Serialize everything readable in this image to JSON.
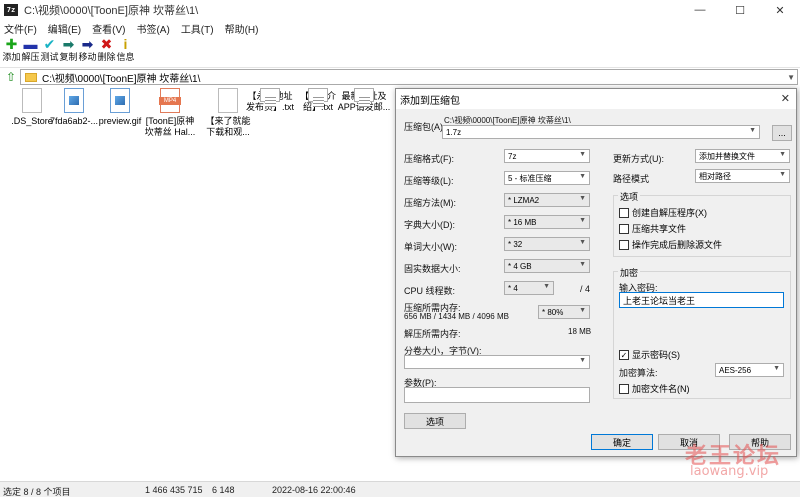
{
  "window": {
    "title": "C:\\视频\\0000\\[ToonE]原神 坎蒂丝\\1\\",
    "icon_text": "7z"
  },
  "menu": [
    "文件(F)",
    "编辑(E)",
    "查看(V)",
    "书签(A)",
    "工具(T)",
    "帮助(H)"
  ],
  "toolbar": [
    {
      "label": "添加",
      "icon": "plus-icon",
      "glyph": "✚",
      "color": "#1aa51a"
    },
    {
      "label": "解压",
      "icon": "minus-icon",
      "glyph": "▬",
      "color": "#2233aa"
    },
    {
      "label": "测试",
      "icon": "check-icon",
      "glyph": "✔",
      "color": "#19b3c4"
    },
    {
      "label": "复制",
      "icon": "copy-arrow-icon",
      "glyph": "➡",
      "color": "#1a7a6a"
    },
    {
      "label": "移动",
      "icon": "move-arrow-icon",
      "glyph": "➡",
      "color": "#1a2a8a"
    },
    {
      "label": "删除",
      "icon": "delete-x-icon",
      "glyph": "✖",
      "color": "#d01818"
    },
    {
      "label": "信息",
      "icon": "info-icon",
      "glyph": "i",
      "color": "#c9a000"
    }
  ],
  "address": {
    "path": "C:\\视频\\0000\\[ToonE]原神 坎蒂丝\\1\\"
  },
  "files": [
    {
      "name": ".DS_Store",
      "type": "blank"
    },
    {
      "name": "7fda6ab2-...",
      "type": "img"
    },
    {
      "name": "preview.gif",
      "type": "img"
    },
    {
      "name": "[ToonE]原神\n坎蒂丝 Hal...",
      "type": "mp4"
    },
    {
      "name": "【来了就能\n下载和观...",
      "type": "blank"
    },
    {
      "name": "【永久地址\n发布页】.txt",
      "type": "txt"
    },
    {
      "name": "【论坛介\n绍】.txt",
      "type": "txt"
    },
    {
      "name": "最新地址及\nAPP请发邮...",
      "type": "txt"
    }
  ],
  "status": {
    "selected": "选定 8 / 8 个项目",
    "size": "1 466 435 715",
    "packed": "6 148",
    "modified": "2022-08-16 22:00:46"
  },
  "dialog": {
    "title": "添加到压缩包",
    "archive_label": "压缩包(A):",
    "archive_path": "C:\\视频\\0000\\[ToonE]原神 坎蒂丝\\1\\",
    "archive_name": "1.7z",
    "browse_label": "...",
    "format_label": "压缩格式(F):",
    "format_value": "7z",
    "level_label": "压缩等级(L):",
    "level_value": "5 - 标准压缩",
    "method_label": "压缩方法(M):",
    "method_value": "* LZMA2",
    "dict_label": "字典大小(D):",
    "dict_value": "* 16 MB",
    "word_label": "单词大小(W):",
    "word_value": "* 32",
    "solid_label": "固实数据大小:",
    "solid_value": "* 4 GB",
    "cpu_label": "CPU 线程数:",
    "cpu_value": "* 4",
    "cpu_total": "/ 4",
    "mem_label": "压缩所需内存:",
    "mem_values": "656 MB / 1434 MB / 4096 MB",
    "mem_percent": "* 80%",
    "decomp_label": "解压所需内存:",
    "decomp_value": "18 MB",
    "split_label": "分卷大小，字节(V):",
    "params_label": "参数(P):",
    "options_button": "选项",
    "update_label": "更新方式(U):",
    "update_value": "添加并替换文件",
    "path_label": "路径模式",
    "path_value": "相对路径",
    "options_group": "选项",
    "opt_sfx": "创建自解压程序(X)",
    "opt_shared": "压缩共享文件",
    "opt_delete": "操作完成后删除源文件",
    "encrypt_group": "加密",
    "password_label": "输入密码:",
    "password_value": "上老王论坛当老王",
    "show_password": "显示密码(S)",
    "enc_method_label": "加密算法:",
    "enc_method_value": "AES-256",
    "enc_names": "加密文件名(N)",
    "ok": "确定",
    "cancel": "取消",
    "help": "帮助"
  },
  "watermark": {
    "main": "老王论坛",
    "sub": "laowang.vip"
  }
}
